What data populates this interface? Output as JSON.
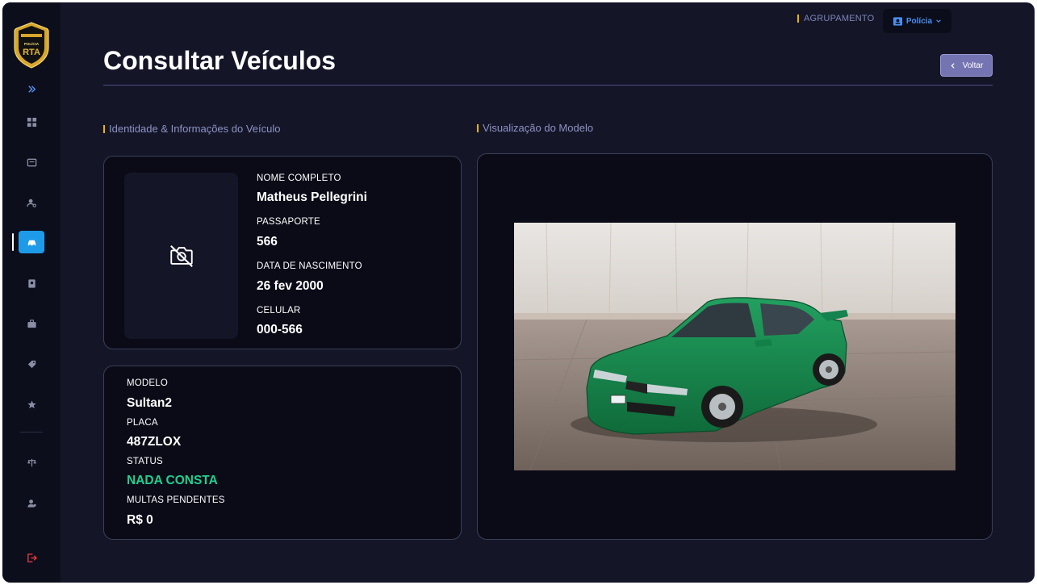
{
  "header": {
    "group_label": "AGRUPAMENTO",
    "group_value": "Polícia",
    "title": "Consultar Veículos",
    "back_label": "Voltar"
  },
  "logo": {
    "text_top": "POLÍCIA",
    "text_main": "RTA"
  },
  "sidebar": {
    "items": [
      {
        "icon": "dashboard-icon"
      },
      {
        "icon": "records-icon"
      },
      {
        "icon": "person-search-icon"
      },
      {
        "icon": "vehicle-icon",
        "active": true
      },
      {
        "icon": "book-icon"
      },
      {
        "icon": "briefcase-icon"
      },
      {
        "icon": "tag-icon"
      },
      {
        "icon": "star-icon"
      },
      {
        "icon": "scale-icon"
      },
      {
        "icon": "officer-icon"
      },
      {
        "icon": "logout-icon"
      }
    ]
  },
  "sections": {
    "identity": "Identidade & Informações do Veículo",
    "model_view": "Visualização do Modelo"
  },
  "owner": {
    "name_label": "NOME COMPLETO",
    "name": "Matheus Pellegrini",
    "passport_label": "PASSAPORTE",
    "passport": "566",
    "birth_label": "DATA DE NASCIMENTO",
    "birth": "26 fev 2000",
    "phone_label": "CELULAR",
    "phone": "000-566"
  },
  "vehicle": {
    "model_label": "MODELO",
    "model": "Sultan2",
    "plate_label": "PLACA",
    "plate": "487ZLOX",
    "status_label": "STATUS",
    "status": "NADA CONSTA",
    "fines_label": "MULTAS PENDENTES",
    "fines": "R$ 0"
  },
  "colors": {
    "background": "#141627",
    "card": "#0a0b17",
    "accent": "#1e9be8",
    "status_ok": "#1fd090",
    "section_marker": "#f0b400",
    "back_button": "#7574b2",
    "car_paint": "#1b8a4f"
  }
}
